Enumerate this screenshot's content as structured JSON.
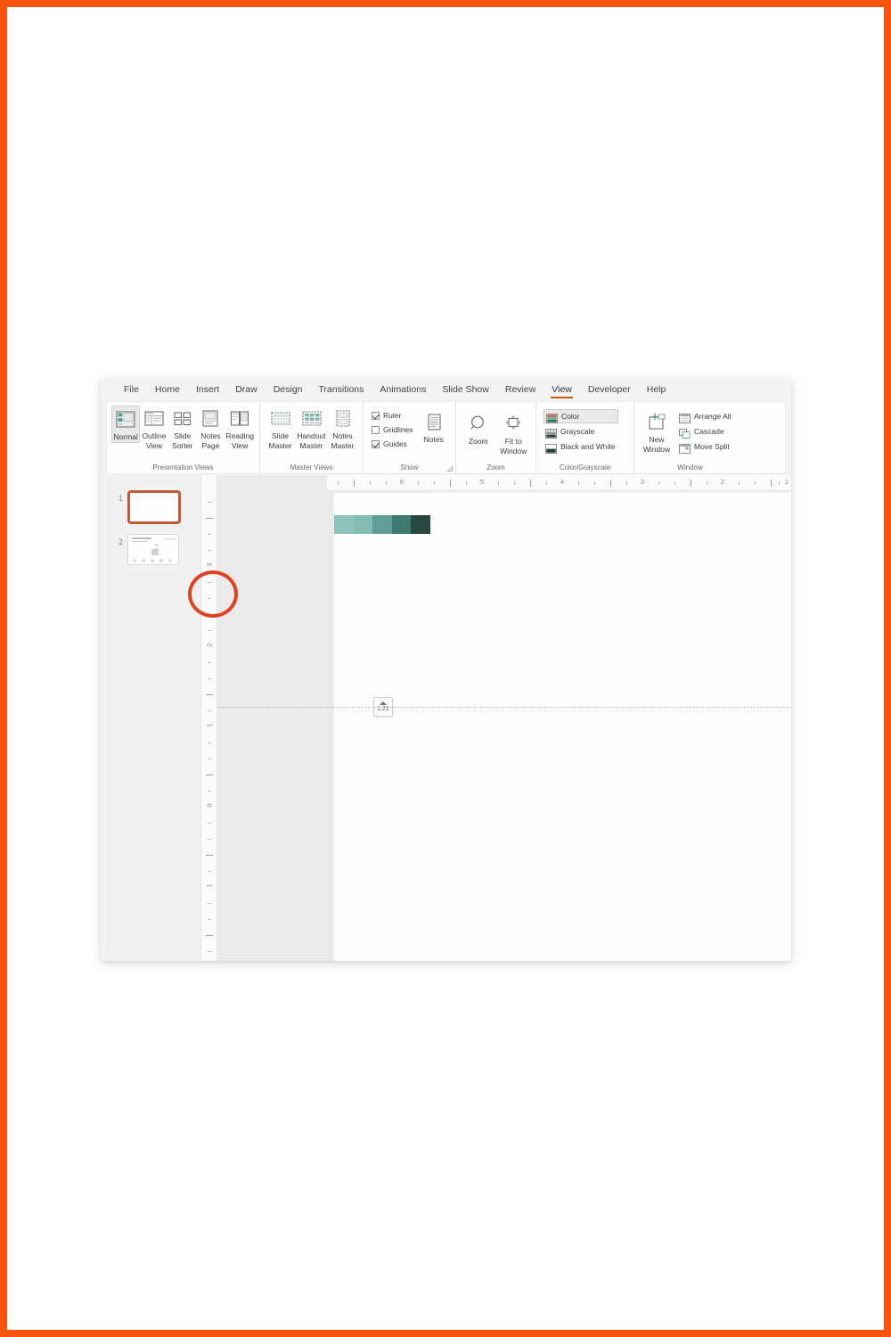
{
  "theme": {
    "page_border_color": "#fa530f",
    "accent_tab_underline": "#c55a11",
    "annotation_color": "#e04321",
    "selected_thumb_border": "#c15a33",
    "ribbon_bg": "#ffffff",
    "window_bg": "#f3f3f3",
    "canvas_bg": "#ffffff"
  },
  "app": {
    "name": "Microsoft PowerPoint",
    "active_tab": "View"
  },
  "tabs": [
    {
      "label": "File",
      "active": false
    },
    {
      "label": "Home",
      "active": false
    },
    {
      "label": "Insert",
      "active": false
    },
    {
      "label": "Draw",
      "active": false
    },
    {
      "label": "Design",
      "active": false
    },
    {
      "label": "Transitions",
      "active": false
    },
    {
      "label": "Animations",
      "active": false
    },
    {
      "label": "Slide Show",
      "active": false
    },
    {
      "label": "Review",
      "active": false
    },
    {
      "label": "View",
      "active": true
    },
    {
      "label": "Developer",
      "active": false
    },
    {
      "label": "Help",
      "active": false
    }
  ],
  "ribbon": {
    "groups": [
      {
        "label": "Presentation Views",
        "buttons": [
          {
            "label": "Normal",
            "line2": "",
            "icon": "normal-view-icon",
            "selected": true
          },
          {
            "label": "Outline",
            "line2": "View",
            "icon": "outline-view-icon",
            "selected": false
          },
          {
            "label": "Slide",
            "line2": "Sorter",
            "icon": "slide-sorter-icon",
            "selected": false
          },
          {
            "label": "Notes",
            "line2": "Page",
            "icon": "notes-page-icon",
            "selected": false
          },
          {
            "label": "Reading",
            "line2": "View",
            "icon": "reading-view-icon",
            "selected": false
          }
        ]
      },
      {
        "label": "Master Views",
        "buttons": [
          {
            "label": "Slide",
            "line2": "Master",
            "icon": "slide-master-icon",
            "selected": false
          },
          {
            "label": "Handout",
            "line2": "Master",
            "icon": "handout-master-icon",
            "selected": false
          },
          {
            "label": "Notes",
            "line2": "Master",
            "icon": "notes-master-icon",
            "selected": false
          }
        ]
      },
      {
        "label": "Show",
        "has_dialog_launcher": true,
        "checkboxes": [
          {
            "label": "Ruler",
            "checked": true
          },
          {
            "label": "Gridlines",
            "checked": false
          },
          {
            "label": "Guides",
            "checked": true
          }
        ],
        "buttons": [
          {
            "label": "Notes",
            "line2": "",
            "icon": "notes-icon",
            "selected": false
          }
        ]
      },
      {
        "label": "Zoom",
        "buttons": [
          {
            "label": "Zoom",
            "line2": "",
            "icon": "zoom-magnifier-icon",
            "selected": false
          },
          {
            "label": "Fit to",
            "line2": "Window",
            "icon": "fit-to-window-icon",
            "selected": false
          }
        ]
      },
      {
        "label": "Color/Grayscale",
        "small_buttons": [
          {
            "label": "Color",
            "icon": "color-swatch-icon",
            "selected": true
          },
          {
            "label": "Grayscale",
            "icon": "grayscale-icon",
            "selected": false
          },
          {
            "label": "Black and White",
            "icon": "black-and-white-icon",
            "selected": false
          }
        ]
      },
      {
        "label": "Window",
        "buttons": [
          {
            "label": "New",
            "line2": "Window",
            "icon": "new-window-icon",
            "selected": false
          }
        ],
        "small_buttons": [
          {
            "label": "Arrange All",
            "icon": "arrange-all-icon",
            "selected": false
          },
          {
            "label": "Cascade",
            "icon": "cascade-icon",
            "selected": false
          },
          {
            "label": "Move Split",
            "icon": "move-split-icon",
            "selected": false
          }
        ]
      }
    ]
  },
  "thumbnails": {
    "slides": [
      {
        "number": "1",
        "selected": true,
        "content": "blank"
      },
      {
        "number": "2",
        "selected": false,
        "content": "title-and-icons"
      }
    ]
  },
  "rulers": {
    "horizontal": {
      "unit": "in",
      "labels": [
        "6",
        "5",
        "4",
        "3",
        "2",
        "1"
      ]
    },
    "vertical": {
      "unit": "in",
      "labels": [
        "3",
        "2",
        "1",
        "0",
        "1"
      ]
    }
  },
  "canvas": {
    "guide": {
      "value": "1.21",
      "arrow": "up-arrow-icon"
    },
    "decoration_bar": {
      "name": "gradient-bar",
      "colors": [
        "#8fc4bc",
        "#84bcb3",
        "#5f9f96",
        "#3f7a70",
        "#27483f"
      ]
    }
  },
  "annotation": {
    "shape": "ellipse",
    "color": "#e04321",
    "target": "vertical-ruler-tick"
  }
}
